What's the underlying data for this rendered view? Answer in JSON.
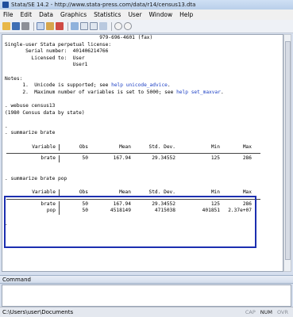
{
  "window": {
    "title": "Stata/SE 14.2 - http://www.stata-press.com/data/r14/census13.dta"
  },
  "menu": [
    "File",
    "Edit",
    "Data",
    "Graphics",
    "Statistics",
    "User",
    "Window",
    "Help"
  ],
  "toolbar": {
    "icons": [
      "open-icon",
      "save-icon",
      "print-icon",
      "log-icon",
      "viewer-icon",
      "graph-icon",
      "dofile-editor-icon",
      "data-editor-icon",
      "data-browser-icon",
      "variables-manager-icon",
      "break-icon",
      "clear-more-icon"
    ]
  },
  "results": {
    "header_lines": [
      "                                979-696-4601 (fax)",
      "",
      "Single-user Stata perpetual license:",
      "       Serial number:  401406214766",
      "         Licensed to:  User",
      "                       User1",
      "",
      "Notes:"
    ],
    "note1_pre": "      1.  Unicode is supported; see ",
    "note1_link": "help unicode_advice",
    "note1_post": ".",
    "note2_pre": "      2.  Maximum number of variables is set to 5000; see ",
    "note2_link": "help set_maxvar",
    "note2_post": ".",
    "cmd_lines": [
      "",
      ". webuse census13",
      "(1980 Census data by state)",
      "",
      ".",
      ". summarize brate",
      ""
    ],
    "table1": {
      "header": [
        "Variable",
        "Obs",
        "Mean",
        "Std. Dev.",
        "Min",
        "Max"
      ],
      "rows": [
        [
          "brate",
          "50",
          "167.94",
          "29.34552",
          "125",
          "286"
        ]
      ]
    },
    "cmd2": ". summarize brate pop",
    "table2": {
      "header": [
        "Variable",
        "Obs",
        "Mean",
        "Std. Dev.",
        "Min",
        "Max"
      ],
      "rows": [
        [
          "brate",
          "50",
          "167.94",
          "29.34552",
          "125",
          "286"
        ],
        [
          "pop",
          "50",
          "4518149",
          "4715038",
          "401851",
          "2.37e+07"
        ]
      ]
    },
    "prompt_tail": "."
  },
  "command": {
    "header": "Command",
    "value": ""
  },
  "status": {
    "path": "C:\\Users\\user\\Documents",
    "indicators": [
      "CAP",
      "NUM",
      "OVR"
    ],
    "active_indicator": "NUM"
  },
  "colors": {
    "highlight_border": "#1c2fb0",
    "link": "#1c3fc4"
  }
}
